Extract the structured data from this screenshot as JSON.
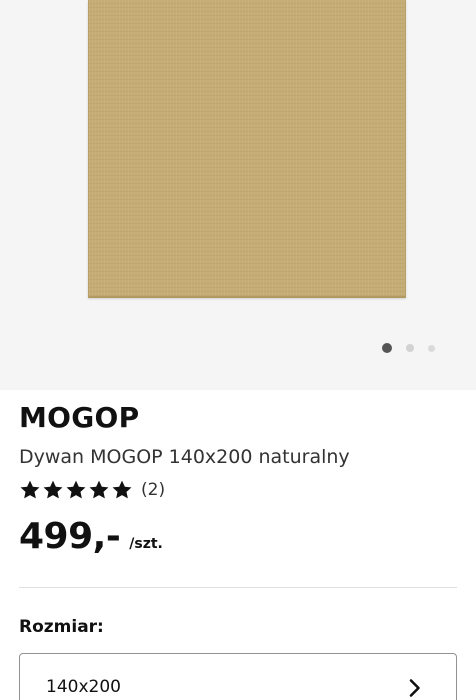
{
  "product": {
    "name": "MOGOP",
    "description": "Dywan MOGOP 140x200 naturalny",
    "rating": {
      "stars": 5,
      "max_stars": 5,
      "count_label": "(2)"
    },
    "price": "499,-",
    "price_unit": "/szt."
  },
  "gallery": {
    "image_alt": "rug-image",
    "rug_color": "#c4ac74",
    "background_color": "#f5f5f5",
    "current_index": 1,
    "total_images": 3
  },
  "size_selector": {
    "label": "Rozmiar:",
    "value": "140x200",
    "icon": "chevron-right-icon"
  }
}
